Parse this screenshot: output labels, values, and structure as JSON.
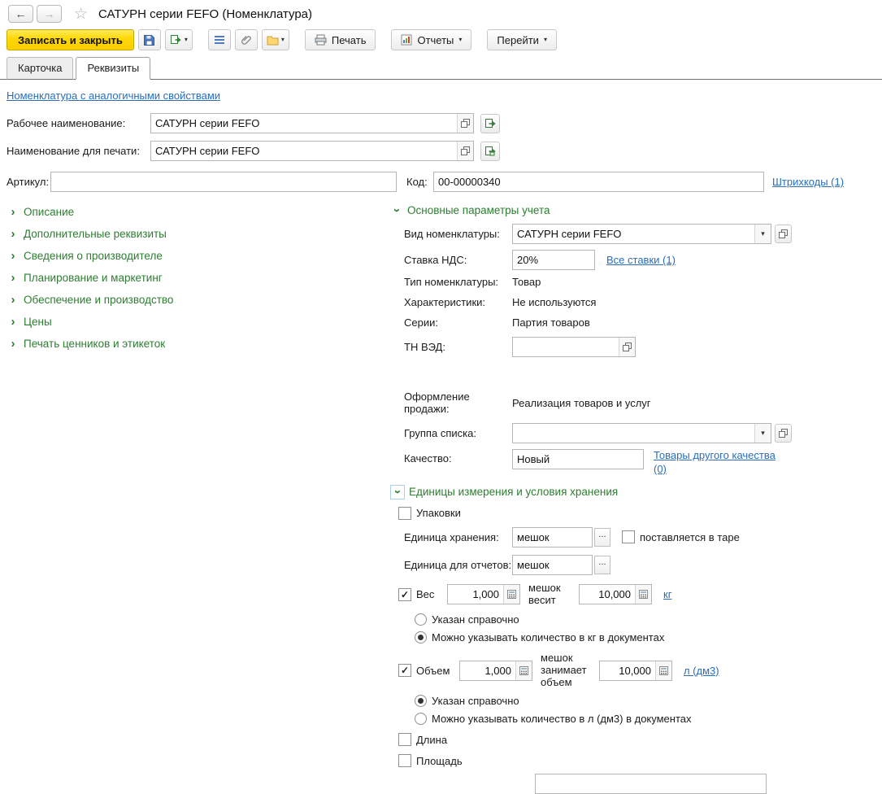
{
  "titlebar": {
    "title": "САТУРН серии FEFO (Номенклатура)"
  },
  "glyphs": {
    "back": "←",
    "forward": "→",
    "star": "☆",
    "chevron": "›",
    "caret": "▾",
    "check": "✓",
    "dots": "..."
  },
  "toolbar": {
    "save_close": "Записать и закрыть",
    "print": "Печать",
    "reports": "Отчеты",
    "goto": "Перейти"
  },
  "tabs": {
    "card": "Карточка",
    "details": "Реквизиты"
  },
  "links": {
    "similar": "Номенклатура с аналогичными свойствами",
    "barcodes": "Штрихкоды (1)",
    "vat_all": "Все ставки (1)",
    "other_quality": "Товары другого качества (0)",
    "kg": "кг",
    "liters": "л (дм3)"
  },
  "fields": {
    "working_label": "Рабочее наименование:",
    "working_value": "САТУРН серии FEFO",
    "print_label": "Наименование для печати:",
    "print_value": "САТУРН серии FEFO",
    "article_label": "Артикул:",
    "article_value": "",
    "code_label": "Код:",
    "code_value": "00-00000340"
  },
  "sections": [
    "Описание",
    "Дополнительные реквизиты",
    "Сведения о производителе",
    "Планирование и маркетинг",
    "Обеспечение и производство",
    "Цены",
    "Печать ценников и этикеток"
  ],
  "main": {
    "title": "Основные параметры учета",
    "kind_label": "Вид номенклатуры:",
    "kind_value": "САТУРН серии FEFO",
    "vat_label": "Ставка НДС:",
    "vat_value": "20%",
    "type_label": "Тип номенклатуры:",
    "type_value": "Товар",
    "char_label": "Характеристики:",
    "char_value": "Не используются",
    "series_label": "Серии:",
    "series_value": "Партия товаров",
    "tnved_label": "ТН ВЭД:",
    "tnved_value": "",
    "sale_label": "Оформление продажи:",
    "sale_value": "Реализация товаров и услуг",
    "group_label": "Группа списка:",
    "group_value": "",
    "quality_label": "Качество:",
    "quality_value": "Новый"
  },
  "units": {
    "title": "Единицы измерения и условия хранения",
    "packaging": "Упаковки",
    "storage_label": "Единица хранения:",
    "storage_value": "мешок",
    "tare": "поставляется в таре",
    "report_label": "Единица для отчетов:",
    "report_value": "мешок",
    "weight_label": "Вес",
    "weight_qty": "1,000",
    "weight_mid": "мешок весит",
    "weight_value": "10,000",
    "weight_ref": "Указан справочно",
    "weight_doc": "Можно указывать количество в кг в документах",
    "volume_label": "Объем",
    "volume_qty": "1,000",
    "volume_mid": "мешок занимает объем",
    "volume_value": "10,000",
    "volume_ref": "Указан справочно",
    "volume_doc": "Можно указывать количество в л (дм3) в документах",
    "length": "Длина",
    "area": "Площадь"
  },
  "colors": {
    "group_green": "#2e7d32",
    "link_blue": "#2a6ebb",
    "action_yellow": "#ffd800"
  }
}
